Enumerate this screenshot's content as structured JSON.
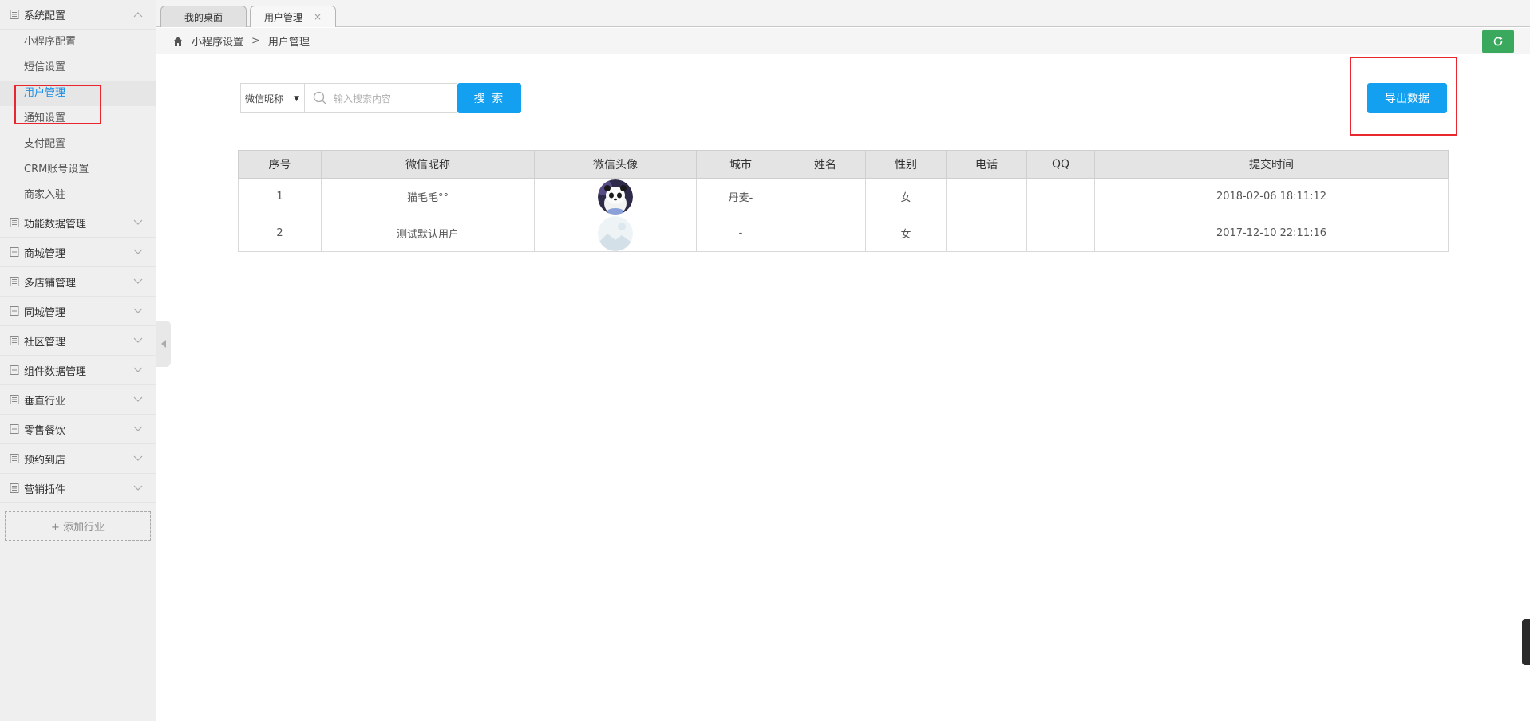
{
  "sidebar": {
    "groups": [
      {
        "label": "系统配置",
        "expanded": true,
        "items": [
          {
            "label": "小程序配置"
          },
          {
            "label": "短信设置"
          },
          {
            "label": "用户管理",
            "active": true
          },
          {
            "label": "通知设置"
          },
          {
            "label": "支付配置"
          },
          {
            "label": "CRM账号设置"
          },
          {
            "label": "商家入驻"
          }
        ]
      },
      {
        "label": "功能数据管理"
      },
      {
        "label": "商城管理"
      },
      {
        "label": "多店铺管理"
      },
      {
        "label": "同城管理"
      },
      {
        "label": "社区管理"
      },
      {
        "label": "组件数据管理"
      },
      {
        "label": "垂直行业"
      },
      {
        "label": "零售餐饮"
      },
      {
        "label": "预约到店"
      },
      {
        "label": "营销插件"
      }
    ],
    "add_industry": "+ 添加行业"
  },
  "tabs": [
    {
      "label": "我的桌面"
    },
    {
      "label": "用户管理",
      "close": "×"
    }
  ],
  "breadcrumb": {
    "level1": "小程序设置",
    "separator": ">",
    "level2": "用户管理"
  },
  "search": {
    "field_select": "微信昵称",
    "placeholder": "输入搜索内容",
    "button": "搜 索"
  },
  "export_button": "导出数据",
  "table": {
    "headers": [
      "序号",
      "微信昵称",
      "微信头像",
      "城市",
      "姓名",
      "性别",
      "电话",
      "QQ",
      "提交时间"
    ],
    "rows": [
      {
        "index": "1",
        "nickname": "猫毛毛°°",
        "avatar": "panda-avatar",
        "city": "丹麦-",
        "name": "",
        "gender": "女",
        "phone": "",
        "qq": "",
        "time": "2018-02-06 18:11:12"
      },
      {
        "index": "2",
        "nickname": "测试默认用户",
        "avatar": "default-avatar",
        "city": "-",
        "name": "",
        "gender": "女",
        "phone": "",
        "qq": "",
        "time": "2017-12-10 22:11:16"
      }
    ]
  },
  "colors": {
    "primary": "#14a0f0",
    "refresh": "#3aa85d",
    "highlight": "#e8262d",
    "active_link": "#1a8fe6"
  }
}
